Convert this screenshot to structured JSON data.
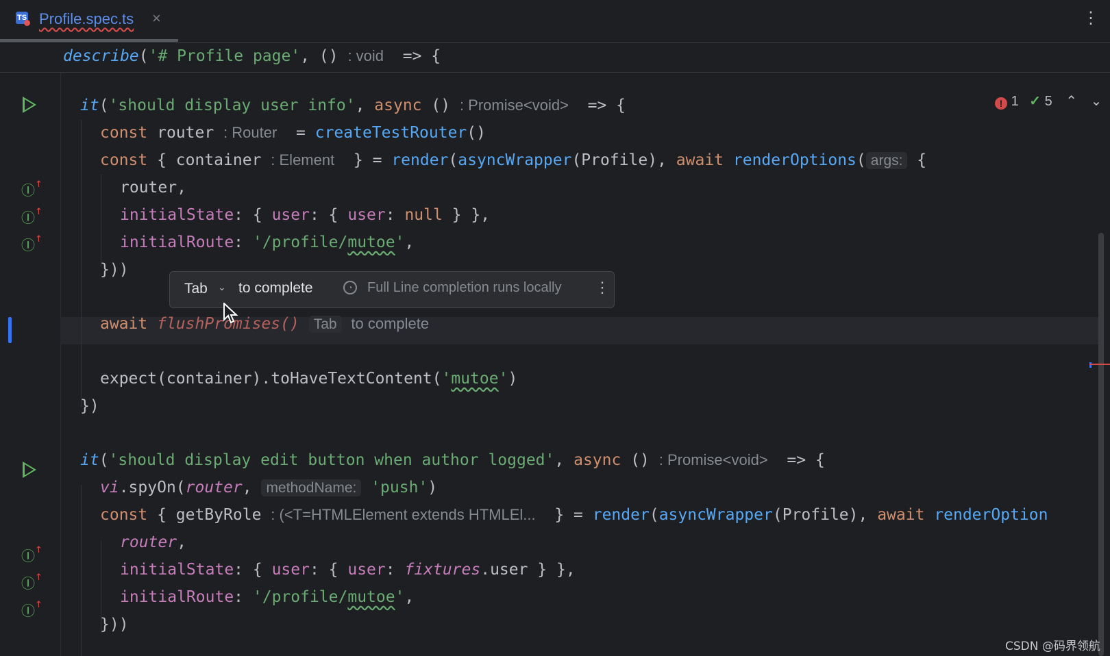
{
  "tab": {
    "title": "Profile.spec.ts",
    "close": "×",
    "icon_label": "TS"
  },
  "toolbar": {
    "more": "⋮"
  },
  "sticky": {
    "describe": "describe",
    "open": "(",
    "string": "'# Profile page'",
    "args": ", ()",
    "hint": ": void",
    "arrow": " => {"
  },
  "inspections": {
    "errors": "1",
    "ok": "5",
    "up": "⌃",
    "down": "⌄"
  },
  "lines": {
    "l1": {
      "it": "it",
      "open": "(",
      "str": "'should display user info'",
      "comma": ", ",
      "async": "async",
      "args": " ()",
      "hint": ": Promise<void>",
      "arrow": " => {"
    },
    "l2": {
      "const": "const",
      "name": " router",
      "hint": ": Router",
      "eq": " = ",
      "fn": "createTestRouter",
      "call": "()"
    },
    "l3": {
      "const": "const",
      "open": " { container",
      "hint": ": Element",
      "close": " } = ",
      "render": "render",
      "p1": "(",
      "wrapper": "asyncWrapper",
      "p2": "(Profile), ",
      "await": "await",
      "sp": " ",
      "opts": "renderOptions",
      "p3": "(",
      "argshint": "args:",
      "brace": " {"
    },
    "l4": {
      "text": "router,"
    },
    "l5": {
      "prop": "initialState",
      "rest1": ": { ",
      "prop2": "user",
      "rest2": ": { ",
      "prop3": "user",
      "rest3": ": ",
      "null": "null",
      "rest4": " } },"
    },
    "l6": {
      "prop": "initialRoute",
      "rest1": ": ",
      "str1": "'/profile/",
      "wavy": "mutoe",
      "str2": "'",
      "comma": ","
    },
    "l7": {
      "text": "}))"
    },
    "l8": {
      "await": "await",
      "flush": "flushPromises()",
      "hint_key": "Tab",
      "hint_text": "to complete"
    },
    "l9": {
      "text1": "expect(container).toHaveTextContent(",
      "str1": "'",
      "wavy": "mutoe",
      "str2": "'",
      "close": ")"
    },
    "l10": {
      "text": "})"
    },
    "l11": {
      "it": "it",
      "open": "(",
      "str": "'should display edit button when author logged'",
      "comma": ", ",
      "async": "async",
      "args": " ()",
      "hint": ": Promise<void>",
      "arrow": " => {"
    },
    "l12": {
      "vi": "vi",
      "dot": ".spyOn(",
      "router": "router",
      "comma": ", ",
      "hint": "methodName:",
      "str": "'push'",
      "close": ")"
    },
    "l13": {
      "const": "const",
      "open": " { getByRole",
      "hint": ": (<T=HTMLElement extends HTMLEl...",
      "close": " } = ",
      "render": "render",
      "p1": "(",
      "wrapper": "asyncWrapper",
      "p2": "(Profile), ",
      "await": "await",
      "sp": " ",
      "opts": "renderOption"
    },
    "l14": {
      "router": "router",
      "comma": ","
    },
    "l15": {
      "prop": "initialState",
      "rest1": ": { ",
      "prop2": "user",
      "rest2": ": { ",
      "prop3": "user",
      "rest3": ": ",
      "fixtures": "fixtures",
      "rest4": ".user } },"
    },
    "l16": {
      "prop": "initialRoute",
      "rest1": ": ",
      "str1": "'/profile/",
      "wavy": "mutoe",
      "str2": "'",
      "comma": ","
    },
    "l17": {
      "text": "}))"
    }
  },
  "popup": {
    "key": "Tab",
    "action": "to complete",
    "info": "Full Line completion runs locally",
    "more": "⋮"
  },
  "watermark": "CSDN @码界领航",
  "colors": {
    "background": "#1e1f22",
    "keyword": "#cf8e6d",
    "string": "#6aab73",
    "function": "#56a8f5",
    "property": "#c77dbb",
    "accent": "#3574f0"
  }
}
